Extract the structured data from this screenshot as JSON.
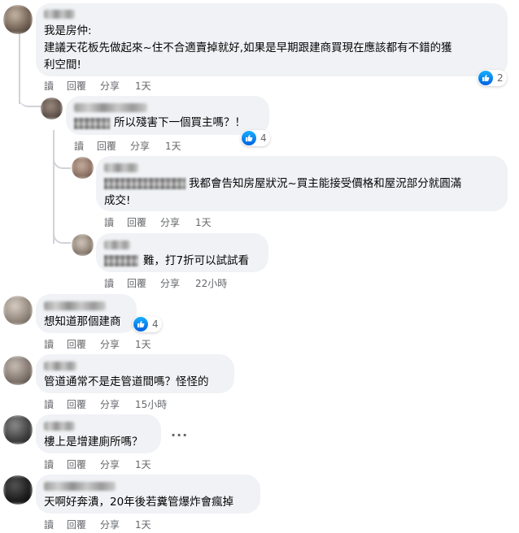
{
  "labels": {
    "read": "讀",
    "reply": "回覆",
    "share": "分享"
  },
  "comments": [
    {
      "text": "我是房仲:\n建議天花板先做起來~住不合適賣掉就好,如果是早期跟建商買現在應該都有不錯的獲\n利空間!",
      "time": "1天",
      "likes": "2"
    },
    {
      "text": "所以殘害下一個買主嗎？！",
      "time": "1天",
      "likes": "4"
    },
    {
      "text": "我都會告知房屋狀況~買主能接受價格和屋況部分就圓滿\n成交!",
      "time": "1天"
    },
    {
      "text": "難，打7折可以試試看",
      "time": "22小時"
    },
    {
      "text": "想知道那個建商",
      "time": "1天",
      "likes": "4"
    },
    {
      "text": "管道通常不是走管道間嗎？怪怪的",
      "time": "15小時"
    },
    {
      "text": "樓上是增建廁所嗎？",
      "time": "1天"
    },
    {
      "text": "天啊好奔潰，20年後若糞管爆炸會瘋掉",
      "time": "1天"
    }
  ],
  "colors": {
    "bubble": "#f0f2f5",
    "meta": "#65676b",
    "like": "#1877f2"
  }
}
